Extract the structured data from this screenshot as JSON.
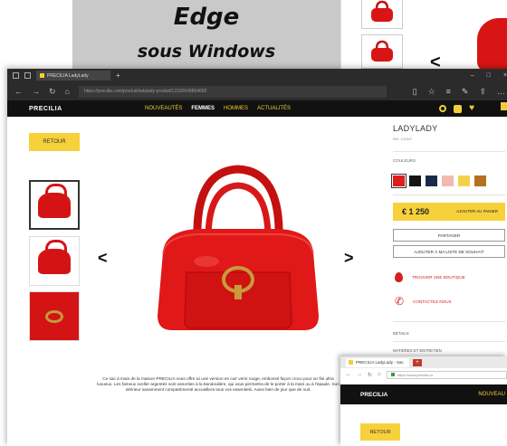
{
  "banner": {
    "title": "Edge",
    "subtitle": "sous Windows"
  },
  "browser": {
    "tab_title": "PRECILIA LadyLady",
    "url": "https://precilia.com/produit/ladylady-produit/12332649854685",
    "window_controls": [
      "–",
      "□",
      "×"
    ]
  },
  "site": {
    "logo": "PRECILIA",
    "menu": [
      {
        "label": "NOUVEAUTÉS",
        "active": false
      },
      {
        "label": "FEMMES",
        "active": true
      },
      {
        "label": "HOMMES",
        "active": false
      },
      {
        "label": "ACTUALITÉS",
        "active": false
      }
    ],
    "back_label": "RETOUR"
  },
  "product": {
    "name": "LADYLADY",
    "reference": "Ref. 1/2/3/2",
    "colors_label": "COULEURS",
    "colors": [
      "#e01b1b",
      "#141414",
      "#1b2a4a",
      "#f4b8b0",
      "#f2d24a",
      "#b5711e"
    ],
    "price": "€ 1 250",
    "add_to_cart": "AJOUTER AU PANIER",
    "share": "PARTAGER",
    "wishlist": "AJOUTER À MA LISTE DE SOUHAIT",
    "find_store": "TROUVER UNE BOUTIQUE",
    "contact": "CONTACTEZ-NOUS",
    "details_label": "DÉTAILS",
    "materials_label": "MATIÈRES ET ENTRETIEN",
    "description": "Ce sac à main de la maison PRECILIA vous offre ici une version en cuir verni rouge, embossé façon croco pour un fini ultra luxueux. Les fameux sceller argentés sont assorties à la bandoulière, qui vous permettra de le porter à la main ou à l'épaule. Son intérieur savamment compartimenté accueillera tous vos essentiels. Aussi bien de jour que de nuit."
  },
  "second_window": {
    "tab_title": "PRECILIA LadyLady - Sac",
    "url": "https://www.precilia.co",
    "logo": "PRECILIA",
    "menu_first": "NOUVEAU",
    "back_label": "RETOUR"
  }
}
